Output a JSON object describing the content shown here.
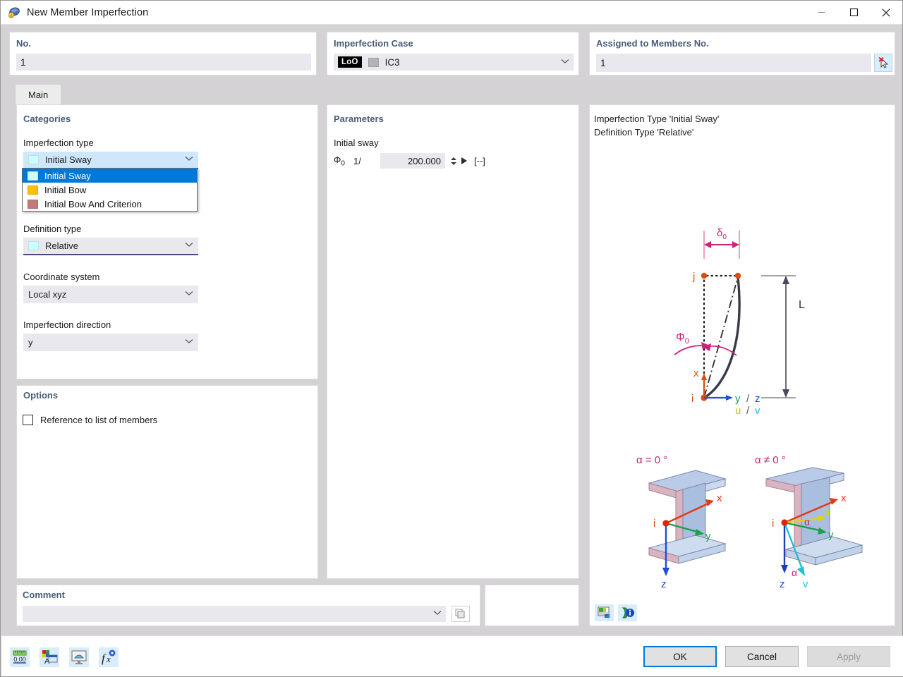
{
  "window": {
    "title": "New Member Imperfection",
    "icon": "member-imperfection-icon",
    "minimize": "—",
    "maximize": "□",
    "close": "✕"
  },
  "header": {
    "no": {
      "title": "No.",
      "value": "1"
    },
    "imperfection_case": {
      "title": "Imperfection Case",
      "badge": "LoO",
      "value": "IC3",
      "swatch_color": "#b4b4b4",
      "caret": "⌄"
    },
    "assigned": {
      "title": "Assigned to Members No.",
      "value": "1",
      "pick_button": "pick-members-icon"
    }
  },
  "tabs": [
    {
      "label": "Main",
      "active": true
    }
  ],
  "categories": {
    "title": "Categories",
    "imperfection_type": {
      "label": "Imperfection type",
      "value": "Initial Sway",
      "swatch_color": "#ccffff",
      "open": true,
      "options": [
        {
          "label": "Initial Sway",
          "color": "#ccffff",
          "selected": true
        },
        {
          "label": "Initial Bow",
          "color": "#ffc000",
          "selected": false
        },
        {
          "label": "Initial Bow And Criterion",
          "color": "#c07a78",
          "selected": false
        }
      ]
    },
    "definition_type": {
      "label": "Definition type",
      "value": "Relative",
      "swatch_color": "#ccffff"
    },
    "coordinate_system": {
      "label": "Coordinate system",
      "value": "Local xyz"
    },
    "imperfection_direction": {
      "label": "Imperfection direction",
      "value": "y"
    }
  },
  "options": {
    "title": "Options",
    "reference_to_list": {
      "label": "Reference to list of members",
      "checked": false
    }
  },
  "parameters": {
    "title": "Parameters",
    "group_label": "Initial sway",
    "symbol": "Φ",
    "symbol_sub": "0",
    "prefix": "1/",
    "value": "200.000",
    "unit": "[--]"
  },
  "comment": {
    "title": "Comment",
    "value": "",
    "placeholder": "",
    "caret": "⌄",
    "copy_button": "comment-copy-icon"
  },
  "preview": {
    "line1": "Imperfection Type 'Initial Sway'",
    "line2": "Definition Type 'Relative'",
    "diagram": {
      "delta_label": "δ",
      "delta_sub": "0",
      "phi_label": "Φ",
      "phi_sub": "0",
      "node_start": "i",
      "node_end": "j",
      "length_label": "L",
      "axis_x": "x",
      "axis_y": "y",
      "axis_z": "z",
      "axis_u": "u",
      "axis_v": "v",
      "sep": "/"
    },
    "sections": [
      {
        "caption": "α = 0 °",
        "origin": "i",
        "axes": [
          "x",
          "y",
          "z"
        ]
      },
      {
        "caption": "α ≠ 0 °",
        "origin": "i",
        "axes": [
          "x",
          "u",
          "y",
          "z",
          "v"
        ],
        "angle_label": "α"
      }
    ],
    "buttons": [
      {
        "name": "export-image-icon"
      },
      {
        "name": "info-icon"
      }
    ]
  },
  "footer": {
    "tools": [
      {
        "name": "units-icon",
        "label": "0,00"
      },
      {
        "name": "display-properties-icon"
      },
      {
        "name": "visibility-icon"
      },
      {
        "name": "formula-icon"
      }
    ],
    "ok": {
      "label": "OK",
      "enabled": true,
      "focused": true
    },
    "cancel": {
      "label": "Cancel",
      "enabled": true
    },
    "apply": {
      "label": "Apply",
      "enabled": false
    }
  },
  "colors": {
    "accent": "#0078d7",
    "group_title": "#4a5b78",
    "field_bg": "#e8e8ee",
    "window_bg": "#d4d2d4"
  }
}
